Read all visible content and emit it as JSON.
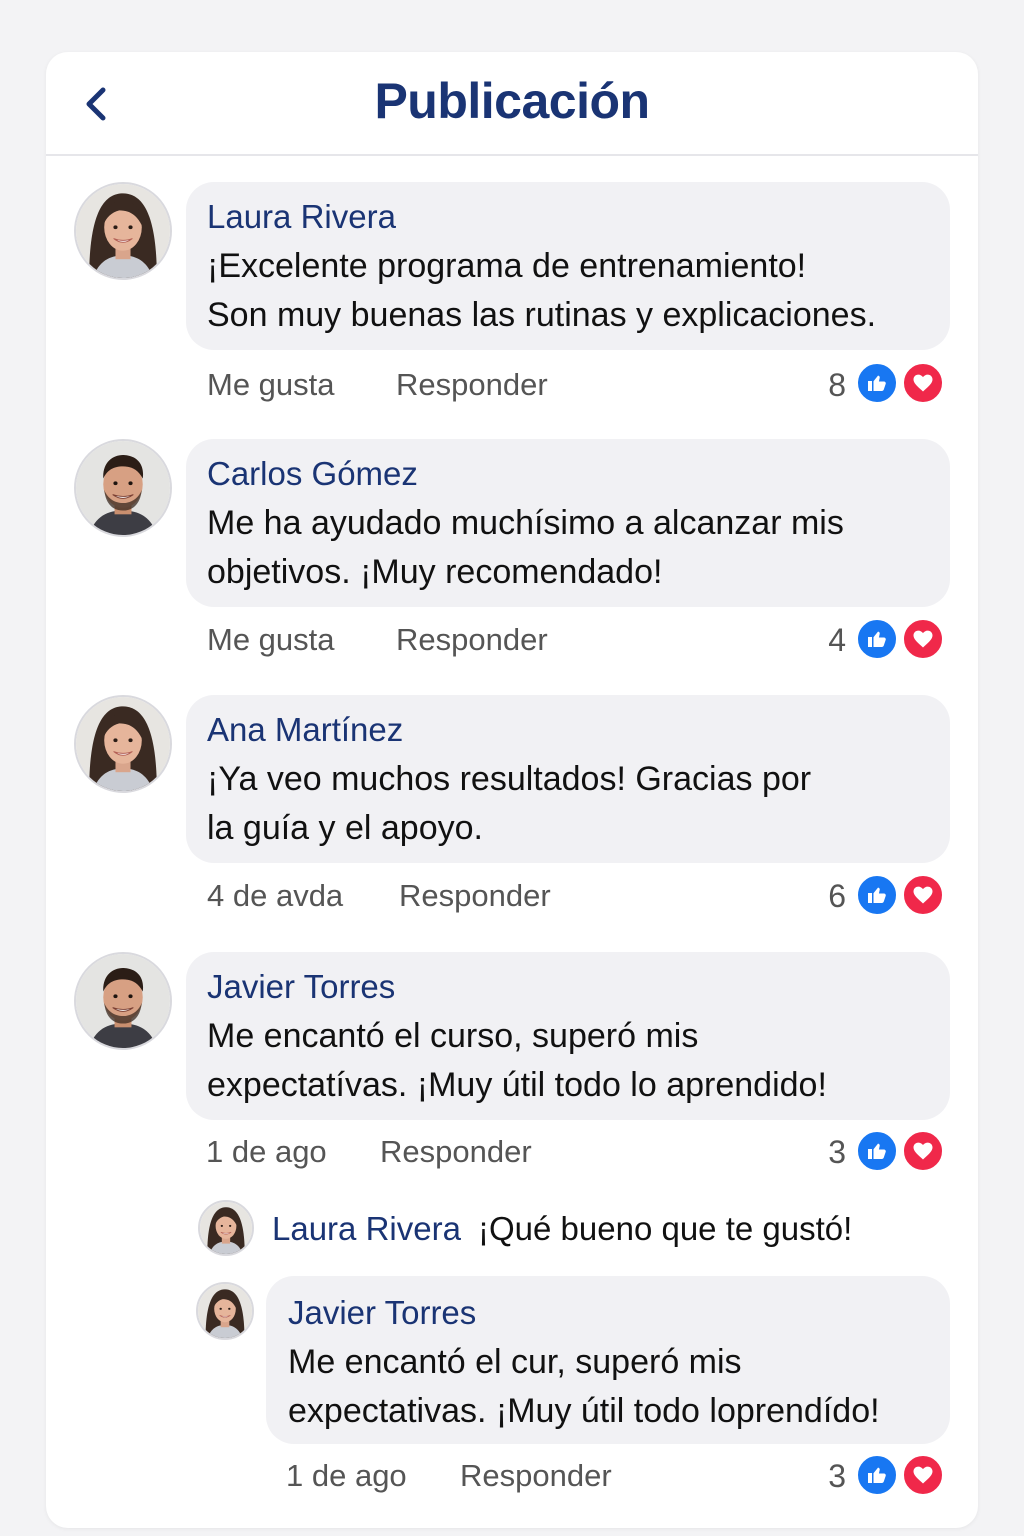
{
  "header": {
    "title": "Publicación",
    "back_icon": "chevron-left-icon"
  },
  "colors": {
    "accent": "#1a3474",
    "like": "#1877f2",
    "love": "#f0284a",
    "bubble": "#f1f1f4"
  },
  "comments": [
    {
      "author": "Laura Rivera",
      "line1": "¡Excelente programa de entrenamiento!",
      "line2": "Son muy buenas las rutinas y explicaciones.",
      "action1": "Me gusta",
      "action2": "Responder",
      "count": "8"
    },
    {
      "author": "Carlos Gómez",
      "line1": "Me ha ayudado muchísimo a alcanzar mis",
      "line2": "objetivos. ¡Muy recomendado!",
      "action1": "Me gusta",
      "action2": "Responder",
      "count": "4"
    },
    {
      "author": "Ana Martínez",
      "line1": "¡Ya veo muchos resultados! Gracias por",
      "line2": "la guía y el apoyo.",
      "action1": "4 de avda",
      "action2": "Responder",
      "count": "6"
    },
    {
      "author": "Javier Torres",
      "line1": "Me encantó el curso, superó mis",
      "line2": "expectatívas. ¡Muy útil todo lo aprendido!",
      "action1": "1 de ago",
      "action2": "Responder",
      "count": "3"
    }
  ],
  "inline_reply": {
    "author": "Laura Rivera",
    "text": "¡Qué bueno que te gustó!"
  },
  "nested_reply": {
    "author": "Javier Torres",
    "line1": "Me encantó el cur, superó mis",
    "line2": "expectativas. ¡Muy útil todo loprendído!",
    "action1": "1 de ago",
    "action2": "Responder",
    "count": "3"
  }
}
